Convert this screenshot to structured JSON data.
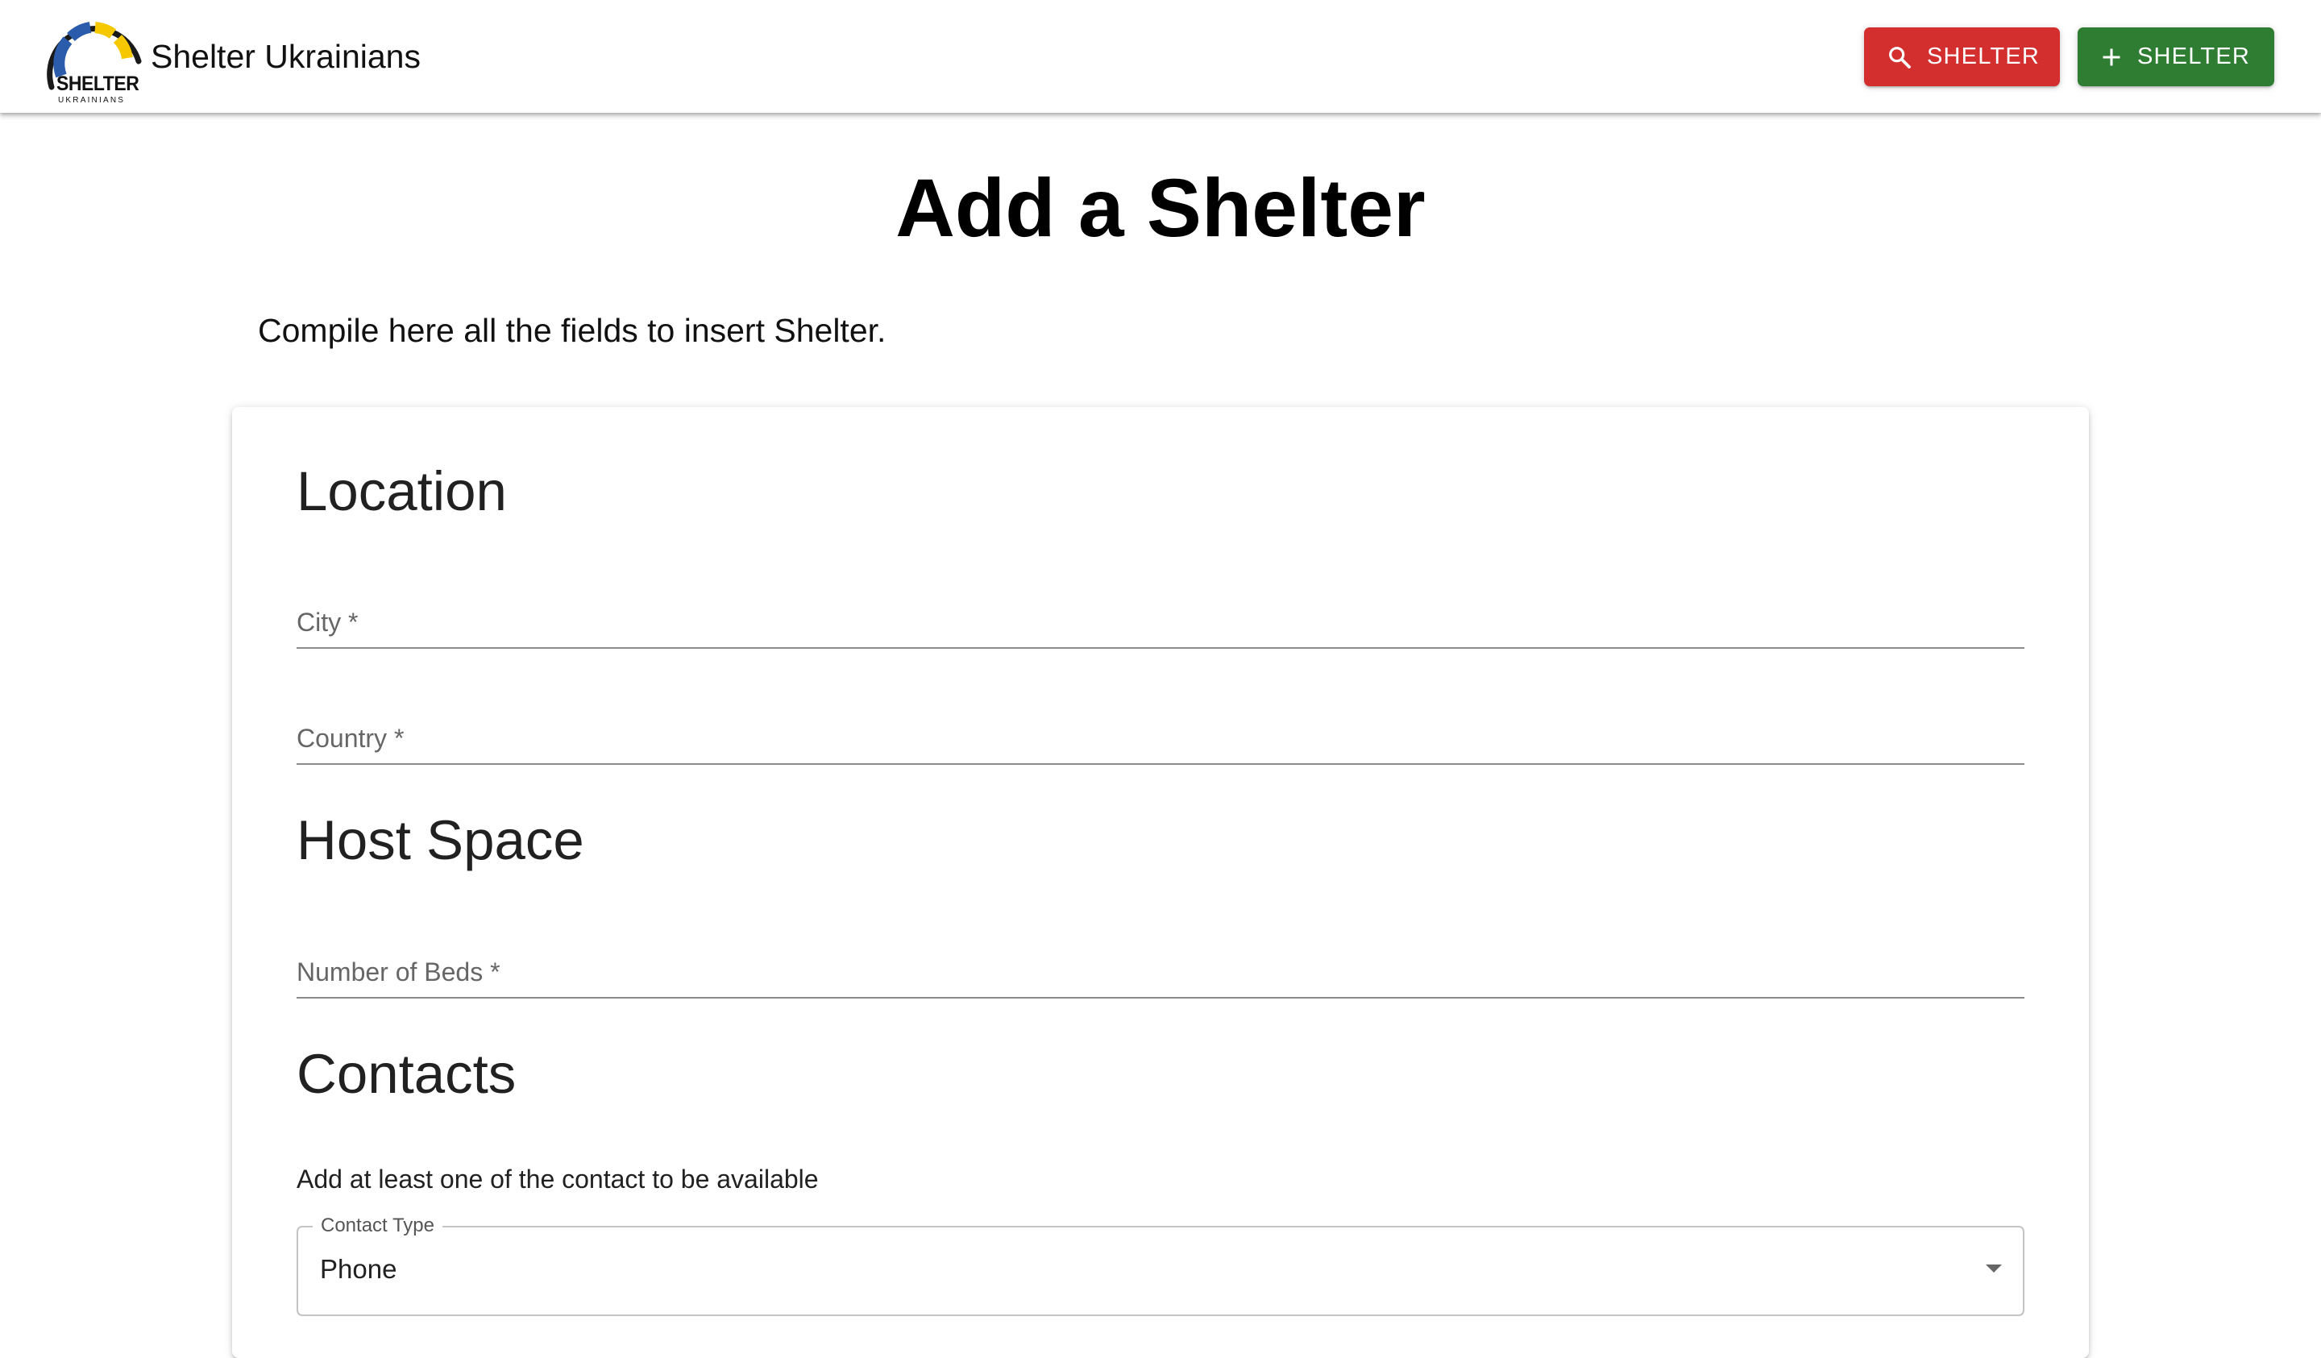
{
  "appbar": {
    "logo": {
      "word": "SHELTER",
      "sub": "UKRAINIANS",
      "colors": {
        "ring": "#1a1a1a",
        "blue": "#2a5cab",
        "yellow": "#f5c800"
      }
    },
    "title": "Shelter Ukrainians",
    "search_button": {
      "label": "SHELTER",
      "icon": "search-icon",
      "color": "#d32f2f"
    },
    "add_button": {
      "label": "SHELTER",
      "icon": "plus-icon",
      "color": "#2e7d32"
    }
  },
  "main": {
    "title": "Add a Shelter",
    "subtitle": "Compile here all the fields to insert Shelter."
  },
  "form": {
    "location": {
      "title": "Location",
      "city_label": "City *",
      "country_label": "Country *"
    },
    "host_space": {
      "title": "Host Space",
      "beds_label": "Number of Beds *"
    },
    "contacts": {
      "title": "Contacts",
      "helper": "Add at least one of the contact to be available",
      "contact_type_label": "Contact Type",
      "contact_type_value": "Phone"
    }
  }
}
